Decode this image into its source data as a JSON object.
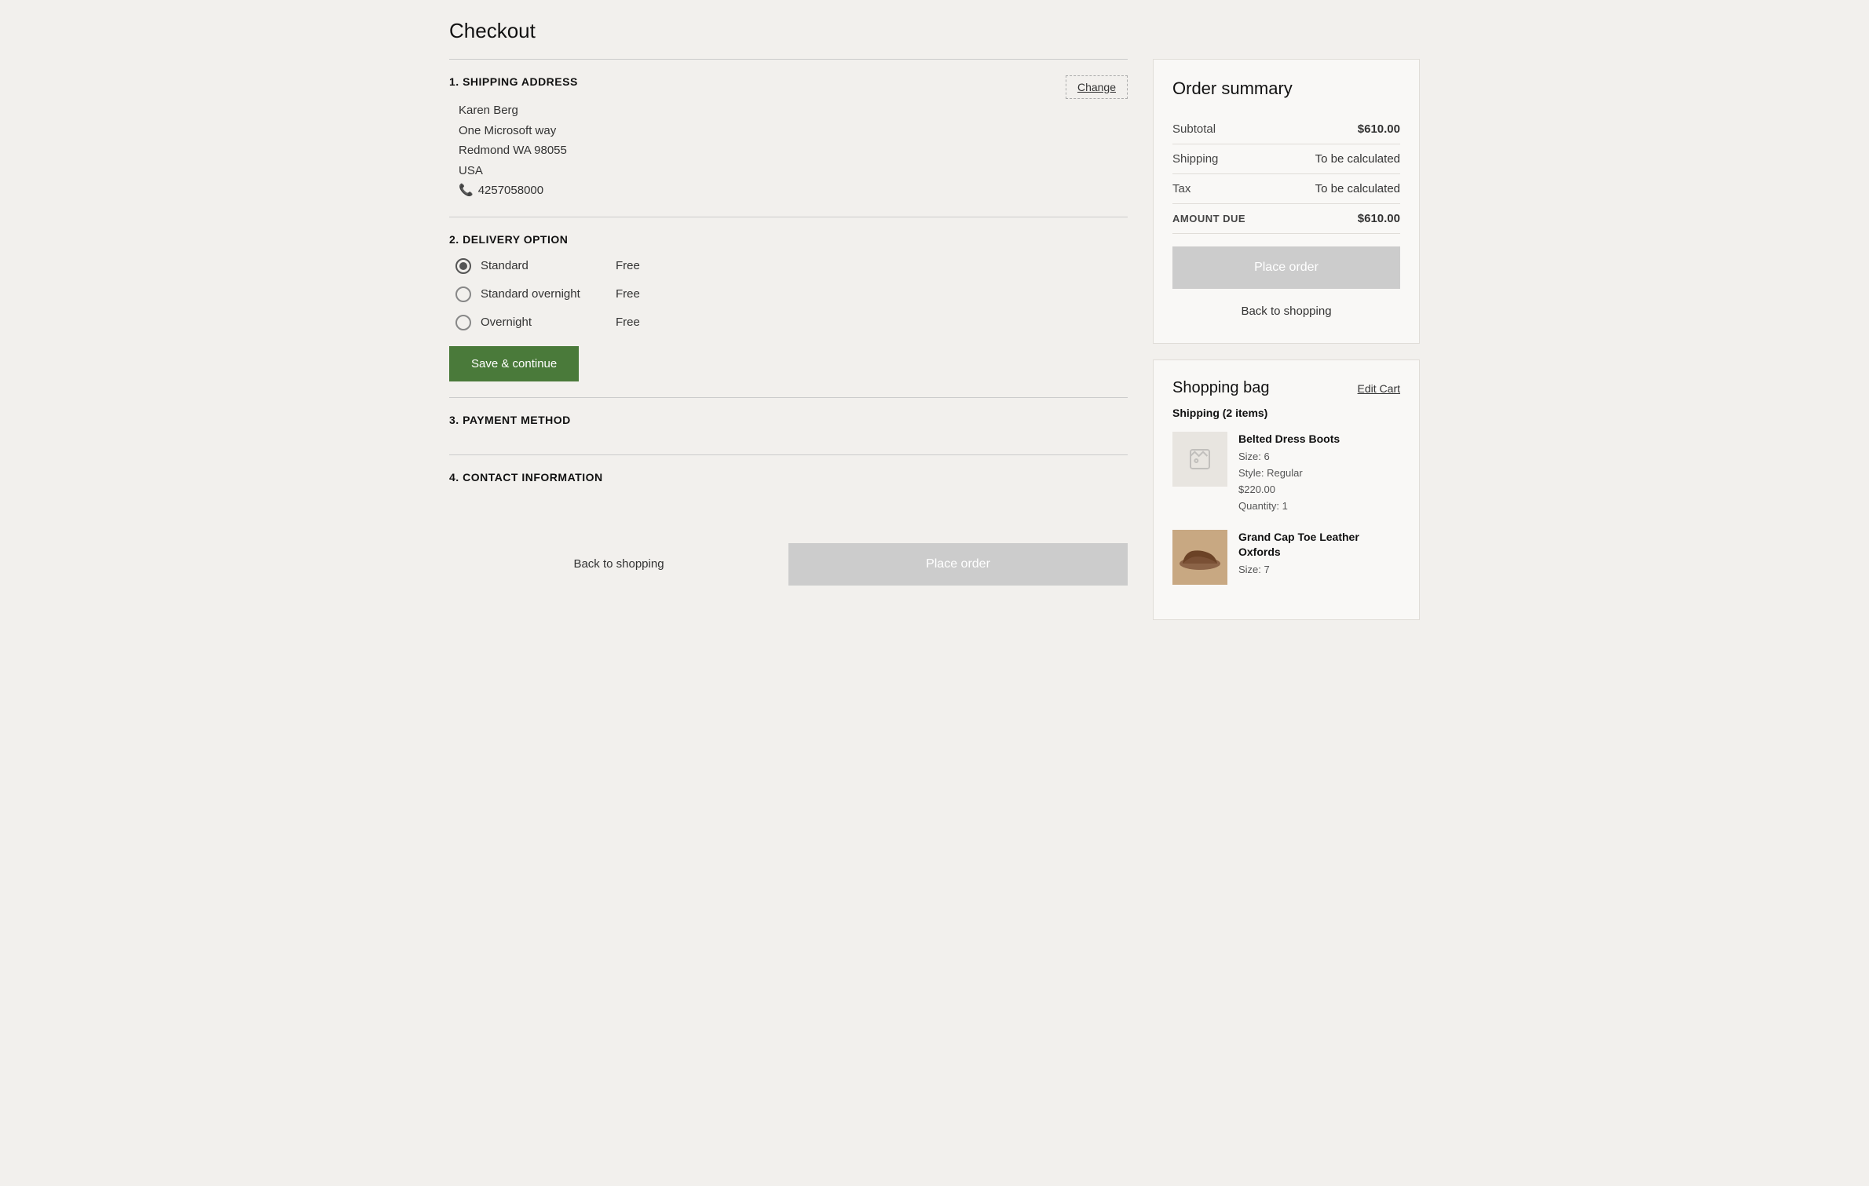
{
  "page": {
    "title": "Checkout"
  },
  "shipping_address": {
    "section_number": "1.",
    "section_title": "SHIPPING ADDRESS",
    "change_button": "Change",
    "name": "Karen Berg",
    "street": "One Microsoft way",
    "city_state_zip": "Redmond WA  98055",
    "country": "USA",
    "phone": "4257058000",
    "phone_icon": "📞"
  },
  "delivery_option": {
    "section_number": "2.",
    "section_title": "DELIVERY OPTION",
    "options": [
      {
        "id": "standard",
        "label": "Standard",
        "price": "Free",
        "selected": true
      },
      {
        "id": "standard-overnight",
        "label": "Standard overnight",
        "price": "Free",
        "selected": false
      },
      {
        "id": "overnight",
        "label": "Overnight",
        "price": "Free",
        "selected": false
      }
    ],
    "save_button": "Save & continue"
  },
  "payment_method": {
    "section_number": "3.",
    "section_title": "PAYMENT METHOD"
  },
  "contact_information": {
    "section_number": "4.",
    "section_title": "CONTACT INFORMATION"
  },
  "bottom_actions": {
    "back_label": "Back to shopping",
    "place_order_label": "Place order"
  },
  "order_summary": {
    "title": "Order summary",
    "subtotal_label": "Subtotal",
    "subtotal_value": "$610.00",
    "shipping_label": "Shipping",
    "shipping_value": "To be calculated",
    "tax_label": "Tax",
    "tax_value": "To be calculated",
    "amount_due_label": "AMOUNT DUE",
    "amount_due_value": "$610.00",
    "place_order_button": "Place order",
    "back_to_shopping": "Back to shopping"
  },
  "shopping_bag": {
    "title": "Shopping bag",
    "edit_cart": "Edit Cart",
    "shipping_items_label": "Shipping (2 items)",
    "items": [
      {
        "name": "Belted Dress Boots",
        "size": "Size: 6",
        "style": "Style: Regular",
        "price": "$220.00",
        "quantity": "Quantity: 1",
        "has_image": false
      },
      {
        "name": "Grand Cap Toe Leather Oxfords",
        "size": "Size: 7",
        "has_image": true
      }
    ]
  }
}
